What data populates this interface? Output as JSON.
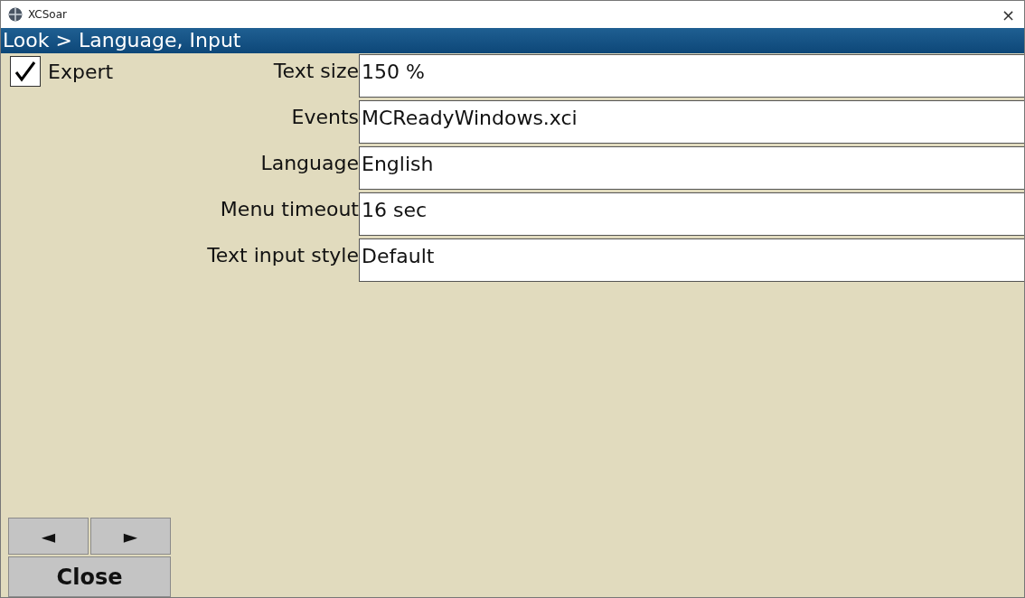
{
  "window": {
    "title": "XCSoar",
    "close": "×"
  },
  "heading": "Look > Language, Input",
  "expert": {
    "label": "Expert",
    "checked": true
  },
  "fields": [
    {
      "label": "Text size",
      "value": "150 %"
    },
    {
      "label": "Events",
      "value": "MCReadyWindows.xci"
    },
    {
      "label": "Language",
      "value": "English"
    },
    {
      "label": "Menu timeout",
      "value": "16 sec"
    },
    {
      "label": "Text input style",
      "value": "Default"
    }
  ],
  "nav": {
    "previous": "◄",
    "next": "►"
  },
  "close_button": "Close"
}
